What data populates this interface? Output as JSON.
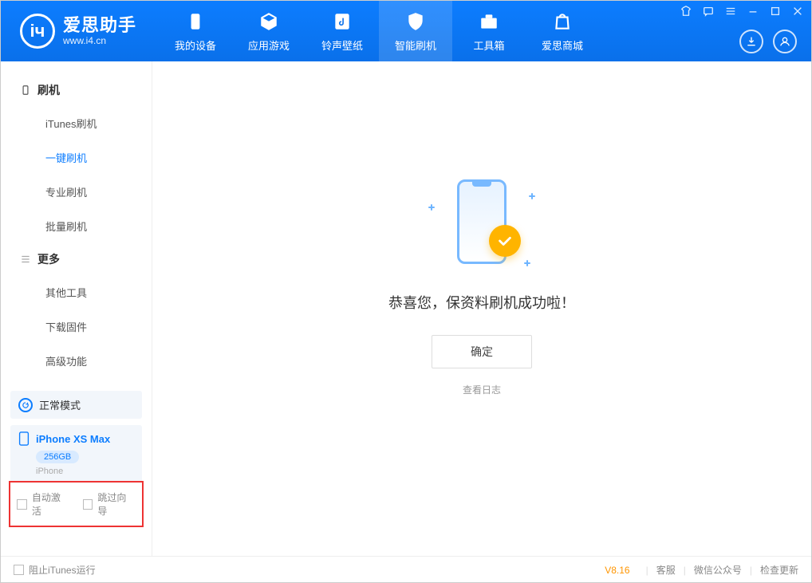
{
  "brand": {
    "title": "爱思助手",
    "subtitle": "www.i4.cn"
  },
  "nav": {
    "device": "我的设备",
    "apps": "应用游戏",
    "ringtone": "铃声壁纸",
    "flash": "智能刷机",
    "toolbox": "工具箱",
    "store": "爱思商城"
  },
  "sidebar": {
    "flash_group": "刷机",
    "more_group": "更多",
    "itunes_flash": "iTunes刷机",
    "one_click_flash": "一键刷机",
    "pro_flash": "专业刷机",
    "batch_flash": "批量刷机",
    "other_tools": "其他工具",
    "download_fw": "下载固件",
    "advanced": "高级功能"
  },
  "mode": {
    "label": "正常模式"
  },
  "device": {
    "name": "iPhone XS Max",
    "storage": "256GB",
    "type": "iPhone"
  },
  "checkboxes": {
    "auto_activate": "自动激活",
    "skip_guide": "跳过向导"
  },
  "main": {
    "success_msg": "恭喜您，保资料刷机成功啦！",
    "confirm": "确定",
    "view_log": "查看日志"
  },
  "footer": {
    "block_itunes": "阻止iTunes运行",
    "version": "V8.16",
    "support": "客服",
    "wechat": "微信公众号",
    "check_update": "检查更新"
  }
}
